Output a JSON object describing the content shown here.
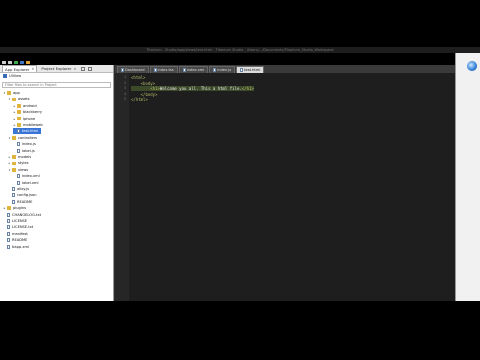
{
  "window": {
    "title": "Titanium - Studio/app/views/test.html - Titanium Studio - /Users/.../Documents/Titanium_Studio_Workspace"
  },
  "explorer": {
    "tabs": [
      {
        "label": "App Explorer",
        "closable": true,
        "active": true
      },
      {
        "label": "Project Explorer",
        "closable": true,
        "active": false
      }
    ],
    "project_name": "UIView",
    "search_placeholder": "Filter files to search in Project",
    "tree": [
      {
        "label": "app",
        "kind": "folder",
        "expanded": true
      },
      {
        "label": "assets",
        "kind": "folder",
        "expanded": true
      },
      {
        "label": "android",
        "kind": "folder",
        "expanded": false
      },
      {
        "label": "blackberry",
        "kind": "folder",
        "expanded": false
      },
      {
        "label": "iphone",
        "kind": "folder",
        "expanded": false
      },
      {
        "label": "mobileweb",
        "kind": "folder",
        "expanded": false
      },
      {
        "label": "test.html",
        "kind": "file",
        "selected": true
      },
      {
        "label": "controllers",
        "kind": "folder",
        "expanded": true
      },
      {
        "label": "index.js",
        "kind": "file"
      },
      {
        "label": "label.js",
        "kind": "file"
      },
      {
        "label": "models",
        "kind": "folder",
        "expanded": false
      },
      {
        "label": "styles",
        "kind": "folder",
        "expanded": false
      },
      {
        "label": "views",
        "kind": "folder",
        "expanded": true
      },
      {
        "label": "index.xml",
        "kind": "file"
      },
      {
        "label": "label.xml",
        "kind": "file"
      },
      {
        "label": "alloy.js",
        "kind": "file"
      },
      {
        "label": "config.json",
        "kind": "file"
      },
      {
        "label": "README",
        "kind": "file"
      },
      {
        "label": "plugins",
        "kind": "folder",
        "expanded": false
      },
      {
        "label": "CHANGELOG.txt",
        "kind": "file"
      },
      {
        "label": "LICENSE",
        "kind": "file"
      },
      {
        "label": "LICENSE.txt",
        "kind": "file"
      },
      {
        "label": "manifest",
        "kind": "file"
      },
      {
        "label": "README",
        "kind": "file"
      },
      {
        "label": "tiapp.xml",
        "kind": "file"
      }
    ]
  },
  "editor": {
    "tabs": [
      {
        "label": "Dashboard",
        "active": false
      },
      {
        "label": "index.tss",
        "active": false
      },
      {
        "label": "index.xml",
        "active": false
      },
      {
        "label": "index.js",
        "active": false
      },
      {
        "label": "test.html",
        "active": true
      }
    ],
    "line_numbers": [
      "1",
      "2",
      "3",
      "4",
      "5"
    ],
    "lines": [
      {
        "indent": "",
        "parts": [
          {
            "cls": "tag",
            "text": "<html>"
          }
        ]
      },
      {
        "indent": "    ",
        "parts": [
          {
            "cls": "tag",
            "text": "<body>"
          }
        ]
      },
      {
        "indent": "        ",
        "parts": [
          {
            "cls": "tag",
            "text": "<h1>"
          },
          {
            "cls": "txt",
            "text": "Welcome you all. This a html file."
          },
          {
            "cls": "tag",
            "text": "</h1>"
          }
        ]
      },
      {
        "indent": "    ",
        "parts": [
          {
            "cls": "tag",
            "text": "</body>"
          }
        ]
      },
      {
        "indent": "",
        "parts": [
          {
            "cls": "tag",
            "text": "</html>"
          }
        ]
      }
    ]
  }
}
